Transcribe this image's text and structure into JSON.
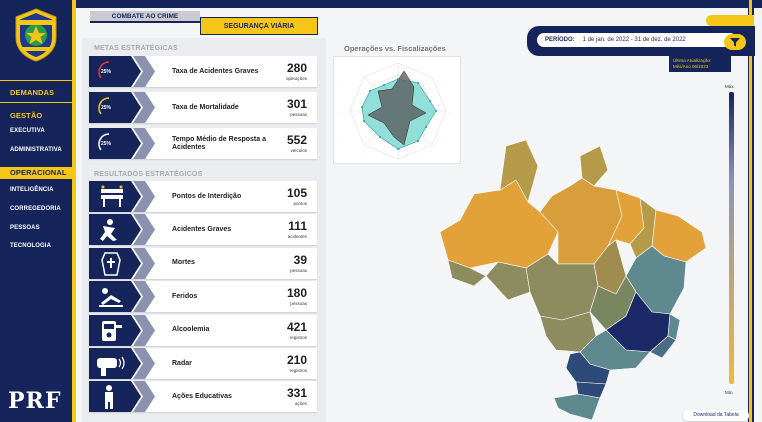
{
  "header": {
    "tab_crime": "COMBATE AO CRIME",
    "tab_viaria": "SEGURANÇA VIÁRIA",
    "period_label": "PERÍODO:",
    "period_value": "1 de jan. de 2022  -  31 de dez. de 2022",
    "update_line1": "Última Atualização:",
    "update_line2": "Mês/Ano    06/2023"
  },
  "sidebar": {
    "logo_text": "PRF",
    "items": [
      {
        "label": "DEMANDAS"
      },
      {
        "label": "GESTÃO"
      },
      {
        "label": "EXECUTIVA"
      },
      {
        "label": "ADMINISTRATIVA"
      },
      {
        "label": "OPERACIONAL"
      },
      {
        "label": "INTELIGÊNCIA"
      },
      {
        "label": "CORREGEDORIA"
      },
      {
        "label": "PESSOAS"
      },
      {
        "label": "TECNOLOGIA"
      }
    ]
  },
  "metas": {
    "title": "METAS ESTRATÉGICAS",
    "cards": [
      {
        "pct": "25%",
        "progress": 0.25,
        "gauge_color": "#e53935",
        "label": "Taxa de Acidentes Graves",
        "value": "280",
        "unit": "operações"
      },
      {
        "pct": "25%",
        "progress": 0.25,
        "gauge_color": "#f5c518",
        "label": "Taxa de Mortalidade",
        "value": "301",
        "unit": "pessoas"
      },
      {
        "pct": "25%",
        "progress": 0.25,
        "gauge_color": "#ffffff",
        "label": "Tempo Médio de Resposta a Acidentes",
        "value": "552",
        "unit": "veículos"
      }
    ]
  },
  "resultados": {
    "title": "RESULTADOS ESTRATÉGICOS",
    "cards": [
      {
        "icon": "roadblock-icon",
        "label": "Pontos de Interdição",
        "value": "105",
        "unit": "pontos"
      },
      {
        "icon": "accident-person-icon",
        "label": "Acidentes Graves",
        "value": "111",
        "unit": "acidentes"
      },
      {
        "icon": "coffin-icon",
        "label": "Mortes",
        "value": "39",
        "unit": "pessoas"
      },
      {
        "icon": "injured-person-icon",
        "label": "Feridos",
        "value": "180",
        "unit": "pessoas"
      },
      {
        "icon": "breathalyzer-icon",
        "label": "Alcoolemia",
        "value": "421",
        "unit": "registros"
      },
      {
        "icon": "radar-gun-icon",
        "label": "Radar",
        "value": "210",
        "unit": "registros"
      },
      {
        "icon": "educator-icon",
        "label": "Ações Educativas",
        "value": "331",
        "unit": "ações"
      }
    ]
  },
  "radar": {
    "title": "Operações vs. Fiscalizações"
  },
  "map": {
    "legend_max": "Máx.",
    "legend_min": "Mín.",
    "download": "Download da Tabela",
    "colors": {
      "dark": "#1b2a66",
      "mid_dark": "#2e4a78",
      "teal": "#5e8a8f",
      "olive": "#8c8c5e",
      "tan": "#b59a4a",
      "orange": "#e3a13a"
    }
  },
  "colors": {
    "navy": "#16245c",
    "gold": "#f5c518"
  }
}
